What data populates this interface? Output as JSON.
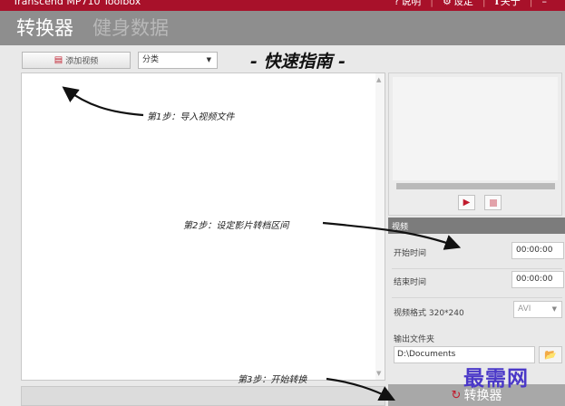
{
  "titlebar": {
    "app_title": "Transcend MP710 Toolbox",
    "help_label": "说明",
    "settings_label": "设定",
    "about_label": "关于",
    "minimize_label": "–"
  },
  "nav": {
    "tab_converter": "转换器",
    "tab_fitness": "健身数据"
  },
  "toolbar": {
    "add_video_label": "添加视频",
    "category_selected": "分类",
    "guide_title": "- 快速指南 -"
  },
  "annotations": {
    "step1": "第1步：导入视频文件",
    "step2": "第2步：设定影片转档区间",
    "step3": "第3步：开始转换"
  },
  "settings": {
    "header": "视频",
    "start_time_label": "开始时间",
    "start_time_value": "00:00:00",
    "end_time_label": "结束时间",
    "end_time_value": "00:00:00",
    "format_label": "视频格式 320*240",
    "format_selected": "AVI",
    "output_folder_label": "输出文件夹",
    "output_folder_value": "D:\\Documents"
  },
  "convert_button_label": "转换器",
  "watermark": "最需网",
  "colors": {
    "title_bar": "#a8112a",
    "accent": "#c01a2c",
    "nav_bg": "#8e8e8e",
    "watermark": "#4a38c8"
  },
  "icons": {
    "help": "question-icon",
    "settings": "gear-icon",
    "about": "info-icon",
    "add_video": "film-icon",
    "play": "play-icon",
    "stop": "stop-icon",
    "folder": "folder-open-icon",
    "convert": "refresh-icon"
  }
}
